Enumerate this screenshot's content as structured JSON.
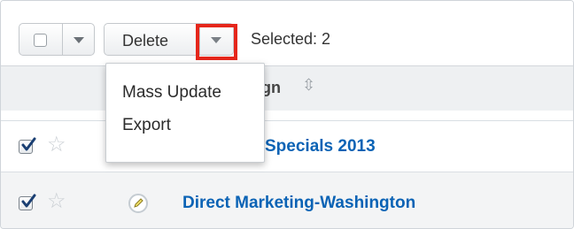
{
  "toolbar": {
    "delete_label": "Delete",
    "selected_label": "Selected: 2"
  },
  "dropdown": {
    "items": [
      {
        "label": "Mass Update"
      },
      {
        "label": "Export"
      }
    ]
  },
  "header": {
    "column_fragment": "gn",
    "sort_icon": "sort-icon"
  },
  "rows": [
    {
      "checked": true,
      "favorite": false,
      "name_visible": "Specials 2013"
    },
    {
      "checked": true,
      "favorite": false,
      "name_visible": "Direct Marketing-Washington"
    }
  ],
  "colors": {
    "link": "#0b63b5",
    "highlight": "#e5261b"
  }
}
